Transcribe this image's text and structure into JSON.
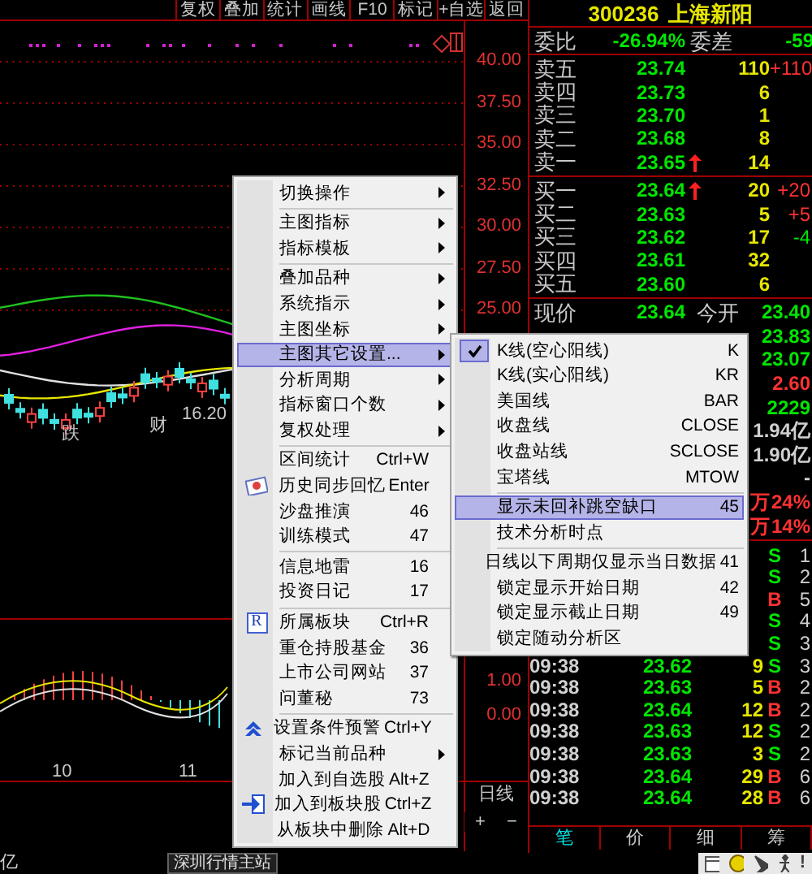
{
  "toolbar": {
    "tabs": [
      "复权",
      "叠加",
      "统计",
      "画线",
      "F10",
      "标记",
      "+自选",
      "返回"
    ]
  },
  "chart": {
    "price_axis": [
      "40.00",
      "37.50",
      "35.00",
      "32.50",
      "30.00",
      "27.50",
      "25.00"
    ],
    "indicator_axis": [
      "1.00",
      "0.00"
    ],
    "date_axis": [
      "10",
      "11"
    ],
    "markers": [
      "跌",
      "财",
      "16.20"
    ],
    "period": "日线",
    "zoom_buttons": [
      "+",
      "−"
    ]
  },
  "quote": {
    "code": "300236",
    "name": "上海新阳",
    "ratio_label": "委比",
    "ratio": "-26.94%",
    "diff_label": "委差",
    "diff": "-59",
    "asks": [
      {
        "label": "卖五",
        "price": "23.74",
        "volume": "110",
        "change": "+110",
        "color": "#ff3232",
        "arrow": false
      },
      {
        "label": "卖四",
        "price": "23.73",
        "volume": "6",
        "arrow": false
      },
      {
        "label": "卖三",
        "price": "23.70",
        "volume": "1",
        "arrow": false
      },
      {
        "label": "卖二",
        "price": "23.68",
        "volume": "8",
        "arrow": false
      },
      {
        "label": "卖一",
        "price": "23.65",
        "volume": "14",
        "arrow": true
      }
    ],
    "bids": [
      {
        "label": "买一",
        "price": "23.64",
        "volume": "20",
        "change": "+20",
        "color": "#ff3232",
        "arrow": true
      },
      {
        "label": "买二",
        "price": "23.63",
        "volume": "5",
        "change": "+5",
        "color": "#ff3232",
        "arrow": false
      },
      {
        "label": "买三",
        "price": "23.62",
        "volume": "17",
        "change": "-4",
        "color": "#00e600",
        "arrow": false
      },
      {
        "label": "买四",
        "price": "23.61",
        "volume": "32",
        "arrow": false
      },
      {
        "label": "买五",
        "price": "23.60",
        "volume": "6",
        "arrow": false
      }
    ],
    "stats": [
      {
        "label": "现价",
        "value": "23.64",
        "label2": "今开",
        "value2": "23.40",
        "color": "#00e600"
      },
      {
        "value2": "23.83",
        "color": "#00e600"
      },
      {
        "value2": "23.07",
        "color": "#00e600"
      },
      {
        "value2": "2.60",
        "color": "#ff3232"
      },
      {
        "value2": "2229",
        "color": "#00e600"
      },
      {
        "value2": "1.94亿",
        "color": "#d0d0d0"
      },
      {
        "value2": "1.90亿",
        "color": "#d0d0d0"
      },
      {
        "value2": "-",
        "color": "#d0d0d0"
      },
      {
        "unit": "万",
        "value2": "24%",
        "color": "#ff3232"
      },
      {
        "unit": "万",
        "value2": "14%",
        "color": "#ff3232"
      }
    ],
    "ticks": [
      {
        "side": "S",
        "count": "1"
      },
      {
        "side": "S",
        "count": "2"
      },
      {
        "side": "B",
        "count": "5"
      },
      {
        "side": "S",
        "count": "4"
      },
      {
        "side": "S",
        "count": "3"
      },
      {
        "time": "09:38",
        "price": "23.62",
        "volume": "9",
        "side": "S",
        "count": "3"
      },
      {
        "time": "09:38",
        "price": "23.63",
        "volume": "5",
        "side": "B",
        "count": "2"
      },
      {
        "time": "09:38",
        "price": "23.64",
        "volume": "12",
        "side": "B",
        "count": "2"
      },
      {
        "time": "09:38",
        "price": "23.63",
        "volume": "12",
        "side": "S",
        "count": "2"
      },
      {
        "time": "09:38",
        "price": "23.63",
        "volume": "3",
        "side": "S",
        "count": "2"
      },
      {
        "time": "09:38",
        "price": "23.64",
        "volume": "29",
        "side": "B",
        "count": "6"
      },
      {
        "time": "09:38",
        "price": "23.64",
        "volume": "28",
        "side": "B",
        "count": "6"
      }
    ],
    "tabs": [
      {
        "label": "笔",
        "selected": true
      },
      {
        "label": "价",
        "selected": false
      },
      {
        "label": "细",
        "selected": false
      },
      {
        "label": "筹",
        "selected": false
      }
    ]
  },
  "status_bar": {
    "left": "亿",
    "server": "深圳行情主站",
    "alert_mark": "!"
  },
  "main_menu": {
    "groups": [
      [
        {
          "label": "切换操作",
          "kind": "plain",
          "submenu": true,
          "selected": false
        }
      ],
      [
        {
          "label": "主图指标",
          "kind": "plain",
          "submenu": true,
          "selected": false
        },
        {
          "label": "指标模板",
          "kind": "plain",
          "submenu": true,
          "selected": false
        }
      ],
      [
        {
          "label": "叠加品种",
          "kind": "plain",
          "submenu": true,
          "selected": false
        },
        {
          "label": "系统指示",
          "kind": "plain",
          "submenu": true,
          "selected": false
        },
        {
          "label": "主图坐标",
          "kind": "plain",
          "submenu": true,
          "selected": false
        },
        {
          "label": "主图其它设置...",
          "kind": "plain",
          "submenu": true,
          "selected": true
        },
        {
          "label": "分析周期",
          "kind": "plain",
          "submenu": true,
          "selected": false
        },
        {
          "label": "指标窗口个数",
          "kind": "plain",
          "submenu": true,
          "selected": false
        },
        {
          "label": "复权处理",
          "kind": "plain",
          "submenu": true,
          "selected": false
        }
      ],
      [
        {
          "label": "区间统计",
          "shortcut": "Ctrl+W",
          "kind": "plain",
          "submenu": false,
          "selected": false
        },
        {
          "label": "历史同步回忆",
          "shortcut": "Enter",
          "kind": "photo",
          "submenu": false,
          "selected": false
        },
        {
          "label": "沙盘推演",
          "shortcut": "46",
          "kind": "plain",
          "submenu": false,
          "selected": false
        },
        {
          "label": "训练模式",
          "shortcut": "47",
          "kind": "plain",
          "submenu": false,
          "selected": false
        }
      ],
      [
        {
          "label": "信息地雷",
          "shortcut": "16",
          "kind": "plain",
          "submenu": false,
          "selected": false
        },
        {
          "label": "投资日记",
          "shortcut": "17",
          "kind": "plain",
          "submenu": false,
          "selected": false
        }
      ],
      [
        {
          "label": "所属板块",
          "shortcut": "Ctrl+R",
          "badge": "R",
          "kind": "badge",
          "submenu": false,
          "selected": false
        },
        {
          "label": "重仓持股基金",
          "shortcut": "36",
          "kind": "plain",
          "submenu": false,
          "selected": false
        },
        {
          "label": "上市公司网站",
          "shortcut": "37",
          "kind": "plain",
          "submenu": false,
          "selected": false
        },
        {
          "label": "问董秘",
          "shortcut": "73",
          "kind": "plain",
          "submenu": false,
          "selected": false
        }
      ],
      [
        {
          "label": "设置条件预警",
          "shortcut": "Ctrl+Y",
          "kind": "alert",
          "submenu": false,
          "selected": false
        },
        {
          "label": "标记当前品种",
          "kind": "plain",
          "submenu": true,
          "selected": false
        },
        {
          "label": "加入到自选股",
          "shortcut": "Alt+Z",
          "kind": "plain",
          "submenu": false,
          "selected": false
        },
        {
          "label": "加入到板块股",
          "shortcut": "Ctrl+Z",
          "kind": "import",
          "submenu": false,
          "selected": false
        },
        {
          "label": "从板块中删除",
          "shortcut": "Alt+D",
          "kind": "plain",
          "submenu": false,
          "selected": false
        }
      ]
    ]
  },
  "sub_menu": {
    "groups": [
      [
        {
          "label": "K线(空心阳线)",
          "shortcut": "K",
          "checked": true,
          "selected": false
        },
        {
          "label": "K线(实心阳线)",
          "shortcut": "KR",
          "checked": false,
          "selected": false
        },
        {
          "label": "美国线",
          "shortcut": "BAR",
          "checked": false,
          "selected": false
        },
        {
          "label": "收盘线",
          "shortcut": "CLOSE",
          "checked": false,
          "selected": false
        },
        {
          "label": "收盘站线",
          "shortcut": "SCLOSE",
          "checked": false,
          "selected": false
        },
        {
          "label": "宝塔线",
          "shortcut": "MTOW",
          "checked": false,
          "selected": false
        }
      ],
      [
        {
          "label": "显示未回补跳空缺口",
          "shortcut": "45",
          "checked": false,
          "selected": true
        },
        {
          "label": "技术分析时点",
          "checked": false,
          "selected": false
        }
      ],
      [
        {
          "label": "日线以下周期仅显示当日数据",
          "shortcut": "41",
          "checked": false,
          "selected": false
        },
        {
          "label": "锁定显示开始日期",
          "shortcut": "42",
          "checked": false,
          "selected": false
        },
        {
          "label": "锁定显示截止日期",
          "shortcut": "49",
          "checked": false,
          "selected": false
        },
        {
          "label": "锁定随动分析区",
          "checked": false,
          "selected": false
        }
      ]
    ]
  }
}
